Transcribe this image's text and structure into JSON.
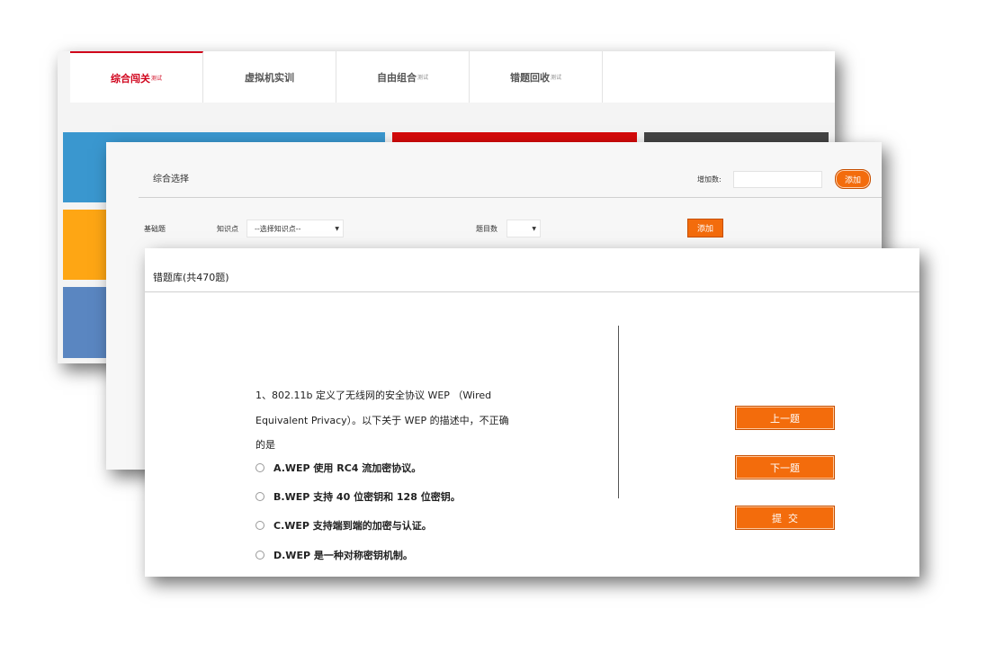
{
  "back": {
    "tabs": [
      {
        "label": "综合闯关",
        "suffix": "测试",
        "active": true
      },
      {
        "label": "虚拟机实训",
        "suffix": "",
        "active": false
      },
      {
        "label": "自由组合",
        "suffix": "测试",
        "active": false
      },
      {
        "label": "错题回收",
        "suffix": "测试",
        "active": false
      }
    ],
    "colors": {
      "blue": "#3a97cf",
      "red": "#d60a0a",
      "dark": "#444444",
      "orange": "#fea614",
      "steel": "#5a86c1",
      "accent": "#d0021b"
    }
  },
  "mid": {
    "title": "综合选择",
    "count_label": "增加数:",
    "add_round": "添加",
    "row": {
      "category": "基础题",
      "knowledge_label": "知识点",
      "knowledge_placeholder": "--选择知识点--",
      "count_label": "题目数",
      "add_label": "添加"
    }
  },
  "front": {
    "title": "错题库(共470题)",
    "question": "1、802.11b 定义了无线网的安全协议 WEP （Wired Equivalent Privacy）。以下关于 WEP 的描述中，不正确的是",
    "options": [
      "A.WEP 使用 RC4 流加密协议。",
      "B.WEP 支持 40 位密钥和 128 位密钥。",
      "C.WEP 支持端到端的加密与认证。",
      "D.WEP 是一种对称密钥机制。"
    ],
    "buttons": {
      "prev": "上一题",
      "next": "下一题",
      "submit": "提  交"
    }
  }
}
